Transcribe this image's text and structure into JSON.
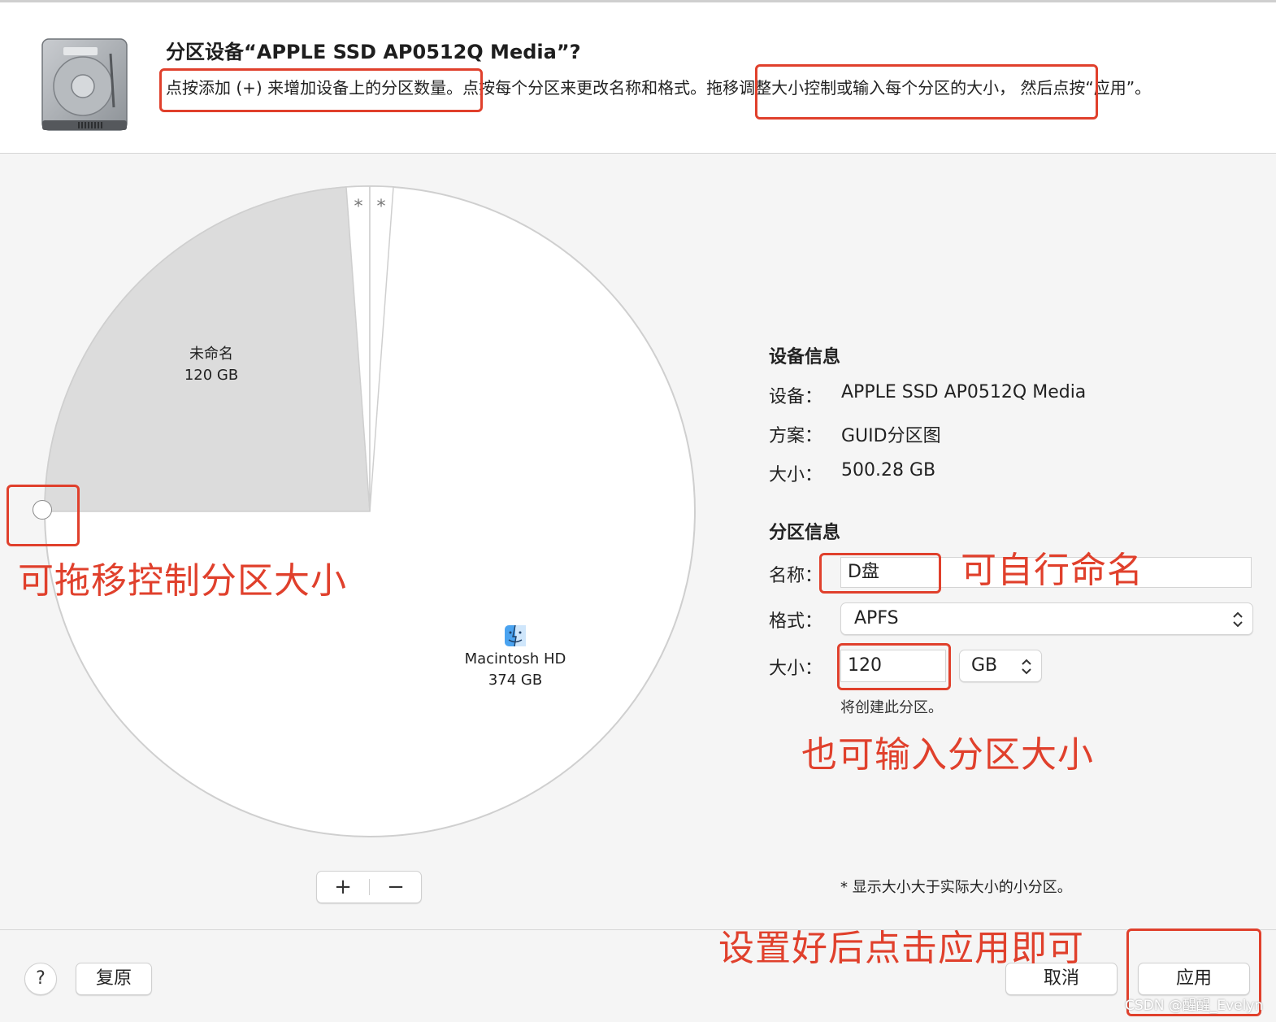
{
  "dialog": {
    "title": "分区设备“APPLE SSD AP0512Q Media”?",
    "desc_part1": "点按添加 (+) 来增加设备上的分区数量。",
    "desc_part2": "点按每个分区来更改名称和格式。",
    "desc_part3": "拖移调整大小控制或输入每个分区的大小，",
    "desc_part4": "然后点按“应用”。"
  },
  "pie": {
    "partitions": [
      {
        "name": "未命名",
        "size_label": "120 GB",
        "size_gb": 120,
        "color": "#dcdcdc"
      },
      {
        "name": "*",
        "size_label": "",
        "color": "#ffffff"
      },
      {
        "name": "*",
        "size_label": "",
        "color": "#ffffff"
      },
      {
        "name": "Macintosh HD",
        "size_label": "374 GB",
        "size_gb": 374,
        "color": "#ffffff"
      }
    ],
    "add_label": "+",
    "remove_label": "−"
  },
  "device_info": {
    "heading": "设备信息",
    "device_label": "设备：",
    "device_value": "APPLE SSD AP0512Q Media",
    "scheme_label": "方案：",
    "scheme_value": "GUID分区图",
    "size_label": "大小：",
    "size_value": "500.28 GB"
  },
  "partition_info": {
    "heading": "分区信息",
    "name_label": "名称：",
    "name_value": "D盘",
    "format_label": "格式：",
    "format_value": "APFS",
    "size_label": "大小：",
    "size_value": "120",
    "unit_value": "GB",
    "hint": "将创建此分区。"
  },
  "footnote": "* 显示大小大于实际大小的小分区。",
  "footer": {
    "help_label": "?",
    "revert_label": "复原",
    "cancel_label": "取消",
    "apply_label": "应用"
  },
  "annotations": {
    "drag": "可拖移控制分区大小",
    "rename": "可自行命名",
    "input_size": "也可输入分区大小",
    "apply": "设置好后点击应用即可"
  },
  "watermark": "CSDN @醒醒_Evelyn",
  "colors": {
    "annotation": "#e0402c",
    "pie_selected": "#dcdcdc"
  }
}
